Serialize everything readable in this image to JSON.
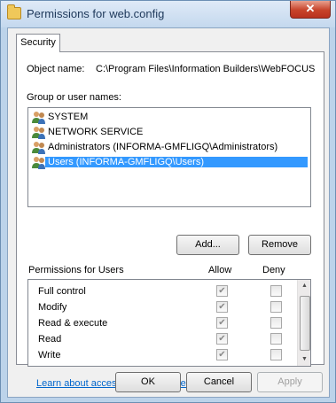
{
  "window": {
    "title": "Permissions for web.config",
    "close_label": "✕"
  },
  "tabs": [
    {
      "label": "Security"
    }
  ],
  "object": {
    "label": "Object name:",
    "value": "C:\\Program Files\\Information Builders\\WebFOCUS"
  },
  "groups": {
    "label": "Group or user names:",
    "items": [
      {
        "name": "SYSTEM",
        "icon": "user-group-icon"
      },
      {
        "name": "NETWORK SERVICE",
        "icon": "user-group-icon"
      },
      {
        "name": "Administrators (INFORMA-GMFLIGQ\\Administrators)",
        "icon": "user-group-icon"
      },
      {
        "name": "Users (INFORMA-GMFLIGQ\\Users)",
        "icon": "user-group-icon",
        "selected": true
      }
    ]
  },
  "buttons": {
    "add": "Add...",
    "remove": "Remove",
    "ok": "OK",
    "cancel": "Cancel",
    "apply": "Apply"
  },
  "permissions": {
    "label": "Permissions for Users",
    "allow_header": "Allow",
    "deny_header": "Deny",
    "rows": [
      {
        "name": "Full control",
        "allow": true,
        "deny": false
      },
      {
        "name": "Modify",
        "allow": true,
        "deny": false
      },
      {
        "name": "Read & execute",
        "allow": true,
        "deny": false
      },
      {
        "name": "Read",
        "allow": true,
        "deny": false
      },
      {
        "name": "Write",
        "allow": true,
        "deny": false
      }
    ]
  },
  "link": "Learn about access control and permissions",
  "colors": {
    "selection": "#3399ff",
    "link": "#0066cc",
    "titlebar": "#c4d8ee"
  }
}
